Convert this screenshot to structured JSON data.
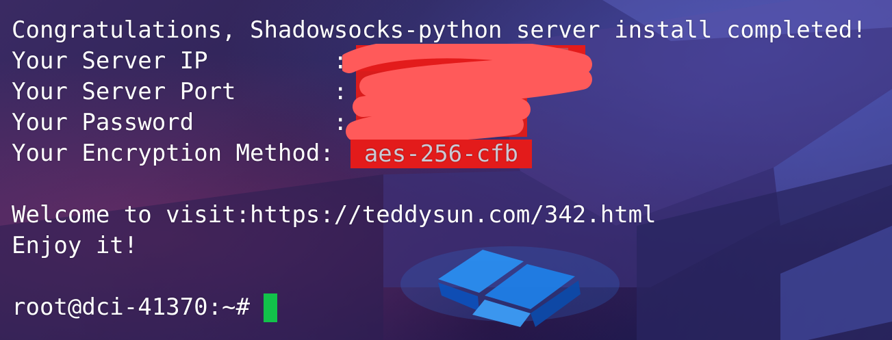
{
  "terminal": {
    "lines": {
      "congrats": "Congratulations, Shadowsocks-python server install completed!",
      "server_ip_label": "Your Server IP",
      "server_port_label": "Your Server Port",
      "password_label": "Your Password",
      "encryption_label": "Your Encryption Method",
      "colon": ":",
      "encryption_value": "aes-256-cfb",
      "welcome": "Welcome to visit:https://teddysun.com/342.html",
      "enjoy": "Enjoy it!",
      "prompt": "root@dci-41370:~#"
    },
    "colors": {
      "text": "#ffffff",
      "highlight": "#e31b1b",
      "redaction": "#ff5555",
      "cursor": "#12c24a"
    }
  }
}
